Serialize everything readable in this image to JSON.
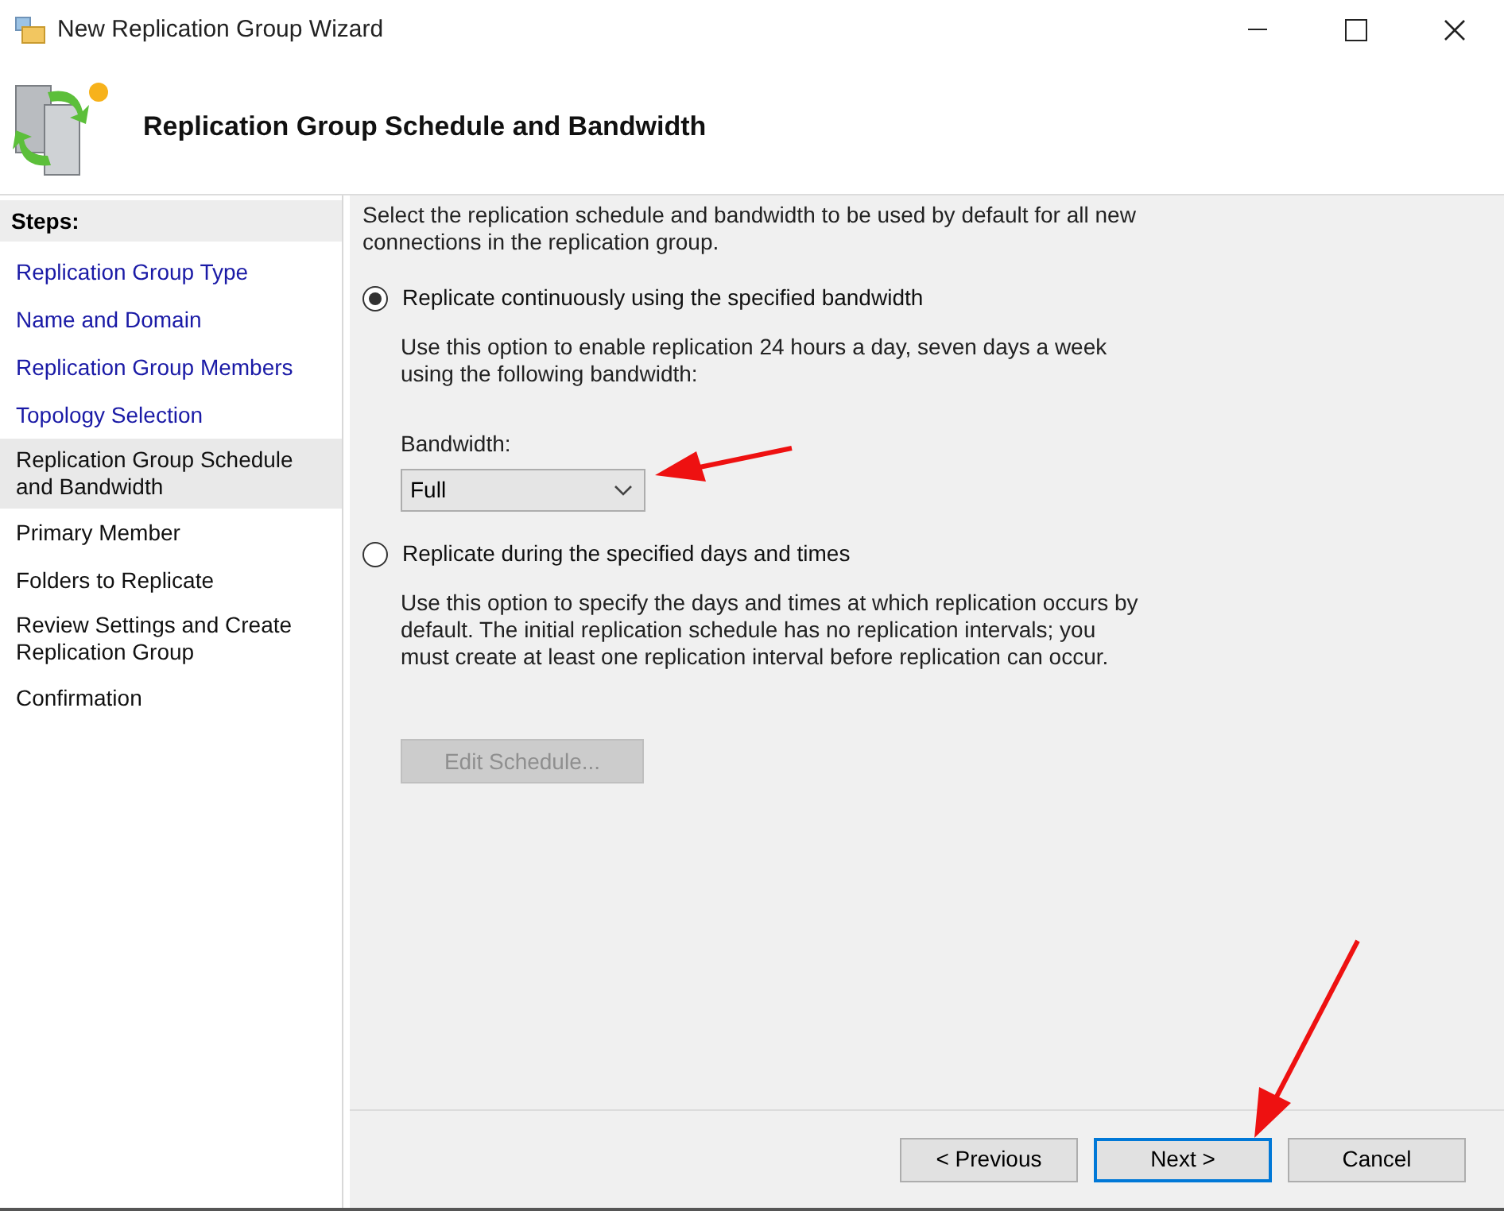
{
  "window": {
    "title": "New Replication Group Wizard"
  },
  "header": {
    "title": "Replication Group Schedule and Bandwidth"
  },
  "sidebar": {
    "heading": "Steps:",
    "items": [
      {
        "label": "Replication Group Type",
        "completed": true,
        "selected": false
      },
      {
        "label": "Name and Domain",
        "completed": true,
        "selected": false
      },
      {
        "label": "Replication Group Members",
        "completed": true,
        "selected": false
      },
      {
        "label": "Topology Selection",
        "completed": true,
        "selected": false
      },
      {
        "label": "Replication Group Schedule and Bandwidth",
        "completed": false,
        "selected": true
      },
      {
        "label": "Primary Member",
        "completed": false,
        "selected": false
      },
      {
        "label": "Folders to Replicate",
        "completed": false,
        "selected": false
      },
      {
        "label": "Review Settings and Create Replication Group",
        "completed": false,
        "selected": false
      },
      {
        "label": "Confirmation",
        "completed": false,
        "selected": false
      }
    ]
  },
  "content": {
    "intro": "Select the replication schedule and bandwidth to be used by default for all new connections in the replication group.",
    "options": [
      {
        "label": "Replicate continuously using the specified bandwidth",
        "selected": true,
        "description": "Use this option to enable replication 24 hours a day, seven days a week using the following bandwidth:",
        "kind": "bandwidth",
        "field_label": "Bandwidth:",
        "value": "Full"
      },
      {
        "label": "Replicate during the specified days and times",
        "selected": false,
        "description": "Use this option to specify the days and times at which replication occurs by default. The initial replication schedule has no replication intervals; you must create at least one replication interval before replication can occur.",
        "kind": "schedule",
        "button": {
          "label": "Edit Schedule...",
          "disabled": true
        }
      }
    ]
  },
  "buttons": [
    {
      "label": "< Previous",
      "focused": false
    },
    {
      "label": "Next >",
      "focused": true
    },
    {
      "label": "Cancel",
      "focused": false
    }
  ]
}
